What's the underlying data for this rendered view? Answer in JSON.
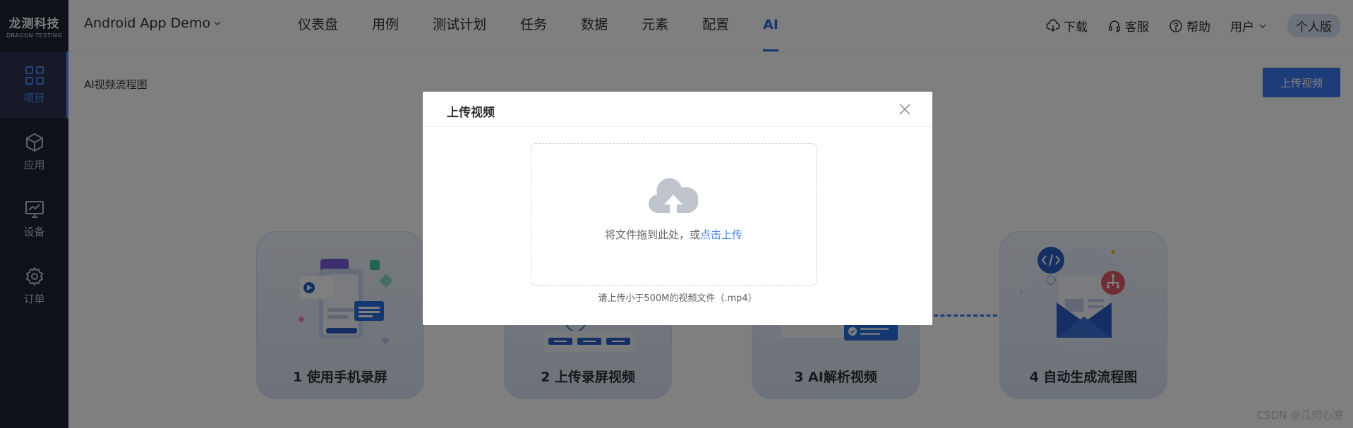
{
  "brand": {
    "name_cn": "龙测科技",
    "name_en": "DRAGON TESTING"
  },
  "sidebar": {
    "items": [
      {
        "label": "项目",
        "icon": "grid-icon",
        "active": true
      },
      {
        "label": "应用",
        "icon": "cube-icon",
        "active": false
      },
      {
        "label": "设备",
        "icon": "monitor-icon",
        "active": false
      },
      {
        "label": "订单",
        "icon": "gear-icon",
        "active": false
      }
    ]
  },
  "header": {
    "project": "Android App Demo",
    "nav": [
      "仪表盘",
      "用例",
      "测试计划",
      "任务",
      "数据",
      "元素",
      "配置",
      "AI"
    ],
    "active_nav": "AI",
    "download": "下载",
    "service": "客服",
    "help": "帮助",
    "user": "用户",
    "edition": "个人版"
  },
  "main": {
    "title": "AI视频流程图",
    "upload_button": "上传视频",
    "steps": [
      "1 使用手机录屏",
      "2 上传录屏视频",
      "3 AI解析视频",
      "4 自动生成流程图"
    ]
  },
  "modal": {
    "title": "上传视频",
    "drop_text": "将文件拖到此处，或",
    "drop_link": "点击上传",
    "tip": "请上传小于500M的视频文件（.mp4）"
  },
  "watermark": "CSDN @几何心凉",
  "colors": {
    "primary": "#3a7bf0",
    "sidebar_bg": "#1e2333",
    "overlay": "rgba(0,0,0,0.5)"
  }
}
